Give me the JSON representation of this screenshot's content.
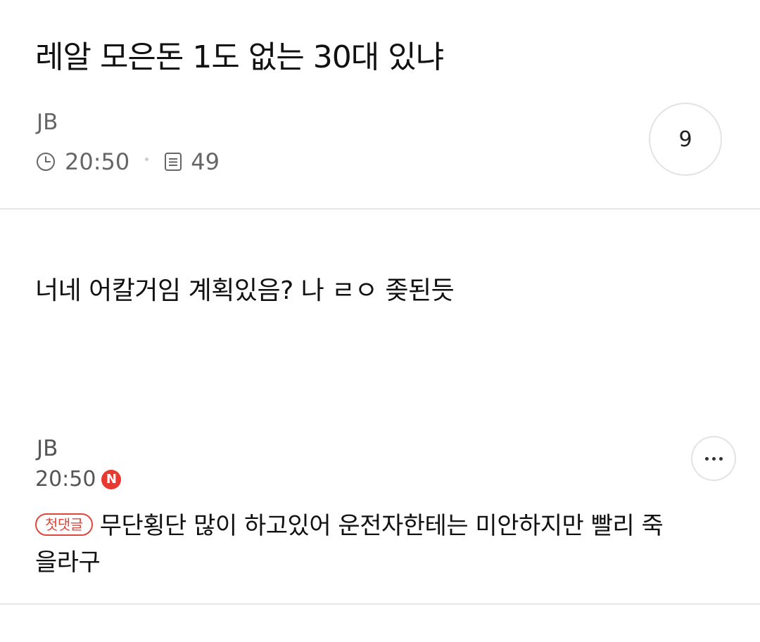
{
  "post": {
    "title": "레알 모은돈 1도 없는 30대 있냐",
    "author": "JB",
    "time": "20:50",
    "views": "49",
    "comment_count": "9",
    "body": "너네 어칼거임 계획있음? 나 ㄹㅇ 좆된듯"
  },
  "comment": {
    "author": "JB",
    "time": "20:50",
    "new_badge": "N",
    "first_badge": "첫댓글",
    "text": "무단횡단 많이 하고있어 운전자한테는 미안하지만 빨리 죽을라구"
  },
  "colors": {
    "accent_red": "#e83a2e",
    "text_primary": "#111111",
    "text_secondary": "#666666",
    "divider": "#e6e6e6"
  },
  "icons": {
    "time": "clock-icon",
    "views": "document-icon",
    "more": "more-dots-icon"
  }
}
